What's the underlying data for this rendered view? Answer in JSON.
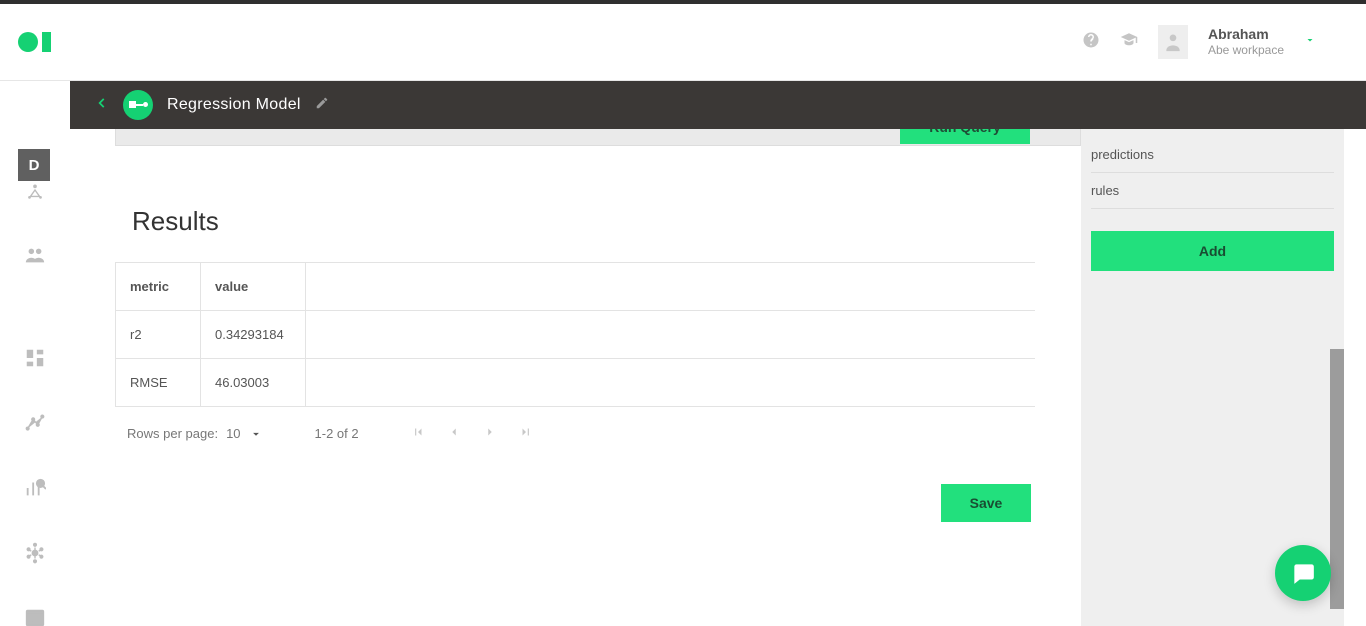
{
  "header": {
    "user_name": "Abraham",
    "user_workspace": "Abe workpace"
  },
  "darkbar": {
    "title": "Regression Model"
  },
  "leftnav": {
    "d_letter": "D"
  },
  "content": {
    "run_query_label": "Run Query",
    "results_title": "Results",
    "table": {
      "headers": [
        "metric",
        "value"
      ],
      "rows": [
        {
          "metric": "r2",
          "value": "0.34293184"
        },
        {
          "metric": "RMSE",
          "value": "46.03003"
        }
      ]
    },
    "pagination": {
      "rows_per_page_label": "Rows per page:",
      "rows_per_page_value": "10",
      "range": "1-2 of 2"
    },
    "save_label": "Save"
  },
  "rightpanel": {
    "items": [
      "predictions",
      "rules"
    ],
    "add_label": "Add"
  },
  "chart_data": {
    "type": "table",
    "columns": [
      "metric",
      "value"
    ],
    "rows": [
      [
        "r2",
        0.34293184
      ],
      [
        "RMSE",
        46.03003
      ]
    ]
  }
}
